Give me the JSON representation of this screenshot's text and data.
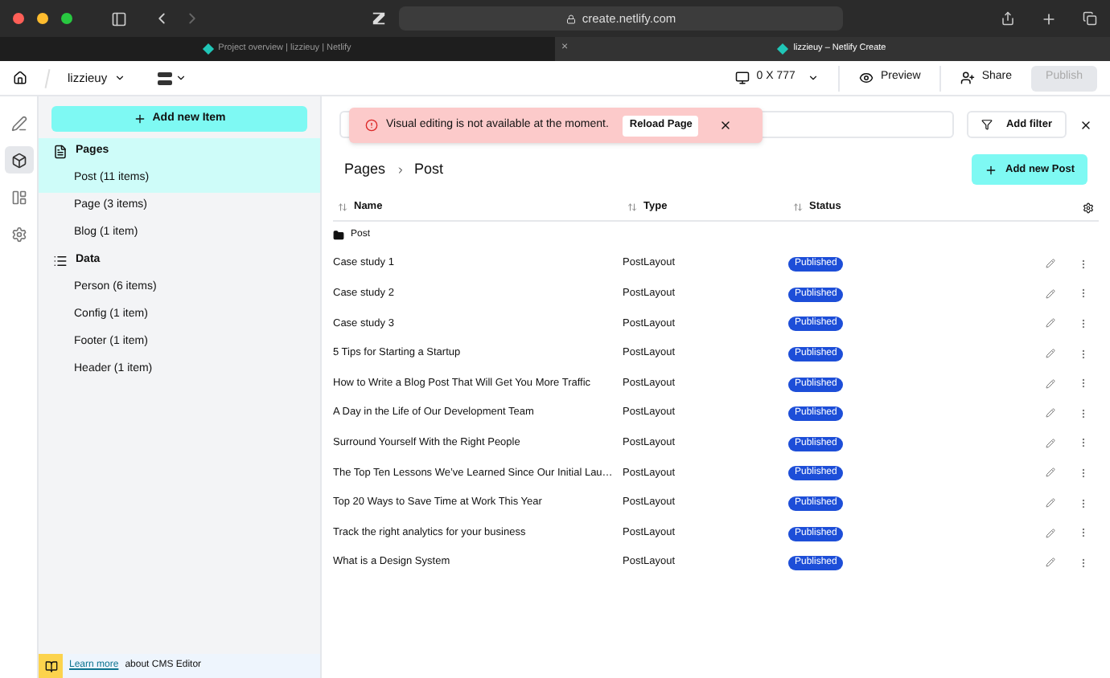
{
  "browser": {
    "url": "create.netlify.com",
    "tabs": [
      {
        "label": "Project overview | lizzieuy | Netlify",
        "selected": false
      },
      {
        "label": "lizzieuy – Netlify Create",
        "selected": true
      }
    ],
    "close_tab": "×"
  },
  "topbar": {
    "project": "lizzieuy",
    "device": "0 X 777",
    "preview": "Preview",
    "share": "Share",
    "publish": {
      "label": "Publish",
      "disabled": true
    }
  },
  "rail": [
    {
      "kind": "pen",
      "selected": false
    },
    {
      "kind": "cube",
      "selected": true
    },
    {
      "kind": "layout",
      "selected": false
    },
    {
      "kind": "gear",
      "selected": false
    }
  ],
  "sidebar": {
    "add_button": "Add new Item",
    "groups": [
      {
        "kind": "pages",
        "label": "Pages",
        "selected": true,
        "items": [
          {
            "label": "Post (11 items)",
            "selected": true
          },
          {
            "label": "Page (3 items)",
            "selected": false
          },
          {
            "label": "Blog (1 item)",
            "selected": false
          }
        ]
      },
      {
        "kind": "data",
        "label": "Data",
        "selected": false,
        "items": [
          {
            "label": "Person (6 items)",
            "selected": false
          },
          {
            "label": "Config (1 item)",
            "selected": false
          },
          {
            "label": "Footer (1 item)",
            "selected": false
          },
          {
            "label": "Header (1 item)",
            "selected": false
          }
        ]
      }
    ],
    "footer": {
      "link": "Learn more",
      "text": "about CMS Editor"
    }
  },
  "toast": {
    "message": "Visual editing is not available at the moment.",
    "action": "Reload Page"
  },
  "filter": {
    "label": "Add filter"
  },
  "breadcrumb": [
    "Pages",
    "Post"
  ],
  "add_post": "Add new Post",
  "table": {
    "columns": [
      "Name",
      "Type",
      "Status"
    ],
    "folder": "Post",
    "rows": [
      {
        "name": "Case study 1",
        "type": "PostLayout",
        "status": "Published"
      },
      {
        "name": "Case study 2",
        "type": "PostLayout",
        "status": "Published"
      },
      {
        "name": "Case study 3",
        "type": "PostLayout",
        "status": "Published"
      },
      {
        "name": "5 Tips for Starting a Startup",
        "type": "PostLayout",
        "status": "Published"
      },
      {
        "name": "How to Write a Blog Post That Will Get You More Traffic",
        "type": "PostLayout",
        "status": "Published"
      },
      {
        "name": "A Day in the Life of Our Development Team",
        "type": "PostLayout",
        "status": "Published"
      },
      {
        "name": "Surround Yourself With the Right People",
        "type": "PostLayout",
        "status": "Published"
      },
      {
        "name": "The Top Ten Lessons We’ve Learned Since Our Initial Lau…",
        "type": "PostLayout",
        "status": "Published"
      },
      {
        "name": "Top 20 Ways to Save Time at Work This Year",
        "type": "PostLayout",
        "status": "Published"
      },
      {
        "name": "Track the right analytics for your business",
        "type": "PostLayout",
        "status": "Published"
      },
      {
        "name": "What is a Design System",
        "type": "PostLayout",
        "status": "Published"
      }
    ]
  }
}
